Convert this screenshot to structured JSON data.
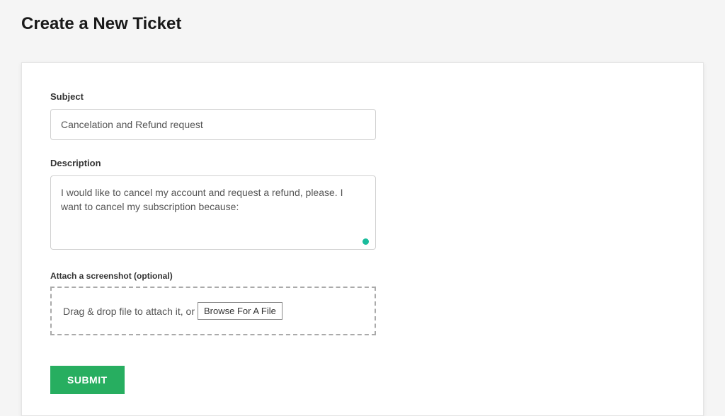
{
  "page": {
    "title": "Create a New Ticket"
  },
  "form": {
    "subject": {
      "label": "Subject",
      "value": "Cancelation and Refund request"
    },
    "description": {
      "label": "Description",
      "value": "I would like to cancel my account and request a refund, please. I want to cancel my subscription because:"
    },
    "attachment": {
      "label": "Attach a screenshot (optional)",
      "dropzone_text": "Drag & drop file to attach it, or ",
      "browse_label": "Browse For A File"
    },
    "submit_label": "SUBMIT"
  },
  "colors": {
    "accent_green": "#27ae60",
    "indicator_teal": "#1abc9c"
  }
}
